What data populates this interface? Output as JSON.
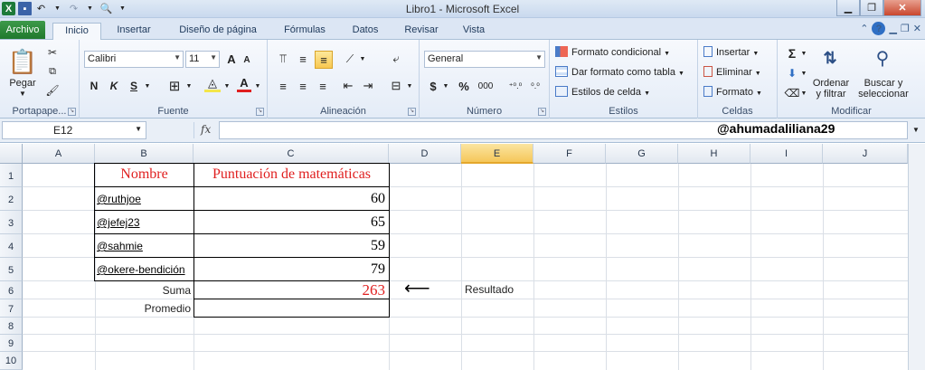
{
  "window": {
    "title": "Libro1  -  Microsoft Excel"
  },
  "tabs": [
    "Archivo",
    "Inicio",
    "Insertar",
    "Diseño de página",
    "Fórmulas",
    "Datos",
    "Revisar",
    "Vista"
  ],
  "ribbon": {
    "clipboard": {
      "paste": "Pegar",
      "label": "Portapape..."
    },
    "font": {
      "name": "Calibri",
      "size": "11",
      "bold": "N",
      "italic": "K",
      "underline": "S",
      "grow": "A",
      "shrink": "A",
      "color_letter": "A",
      "label": "Fuente"
    },
    "alignment": {
      "label": "Alineación"
    },
    "number": {
      "format": "General",
      "currency": "$",
      "percent": "%",
      "thousands": "000",
      "inc_dec": "⁺⁰.⁰",
      "dec_dec": "⁰.⁰",
      "label": "Número"
    },
    "styles": {
      "conditional": "Formato condicional",
      "as_table": "Dar formato como tabla",
      "cell_styles": "Estilos de celda",
      "label": "Estilos"
    },
    "cells": {
      "insert": "Insertar",
      "delete": "Eliminar",
      "format": "Formato",
      "label": "Celdas"
    },
    "editing": {
      "sum": "Σ",
      "sort_1": "Ordenar",
      "sort_2": "y filtrar",
      "find_1": "Buscar y",
      "find_2": "seleccionar",
      "label": "Modificar"
    }
  },
  "formula_bar": {
    "name_box": "E12",
    "fx": "fx",
    "overlay_text": "@ahumadaliliana29"
  },
  "columns": [
    "A",
    "B",
    "C",
    "D",
    "E",
    "F",
    "G",
    "H",
    "I",
    "J"
  ],
  "rows": [
    "1",
    "2",
    "3",
    "4",
    "5",
    "6",
    "7",
    "8",
    "9",
    "10"
  ],
  "sheet": {
    "header_name": "Nombre",
    "header_score": "Puntuación de matemáticas",
    "entries": [
      {
        "name": "@ruthjoe",
        "score": "60"
      },
      {
        "name": "@jefej23",
        "score": "65"
      },
      {
        "name": "@sahmie",
        "score": "59"
      },
      {
        "name": "@okere-bendición",
        "score": "79"
      }
    ],
    "sum_label": "Suma",
    "sum_value": "263",
    "avg_label": "Promedio",
    "arrow": "⟵",
    "result_label": "Resultado"
  },
  "colors": {
    "accent_red": "#e01f1f",
    "file_tab": "#20792d",
    "selected_col": "#f5c75a"
  }
}
